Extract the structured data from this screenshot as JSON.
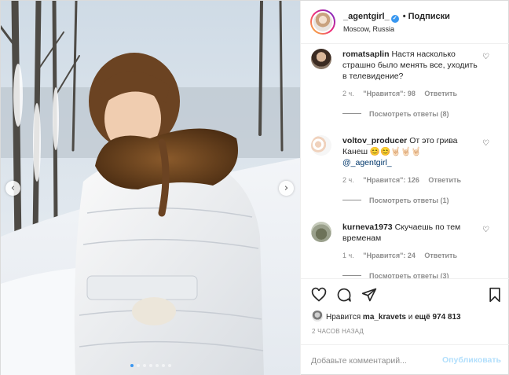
{
  "post": {
    "username": "_agentgirl_",
    "separator": "•",
    "follow_label": "Подписки",
    "location": "Moscow, Russia",
    "photo": {
      "subject": "girl-in-white-winter-coat-photo",
      "slide_count": 7,
      "active_slide": 1
    }
  },
  "comments": [
    {
      "username": "romatsaplin",
      "text": "Настя насколько страшно было менять все, уходить в телевидение?",
      "time": "2 ч.",
      "likes_label": "\"Нравится\": 98",
      "reply_label": "Ответить",
      "view_replies": "Посмотреть ответы (8)"
    },
    {
      "username": "voltov_producer",
      "text": "От это грива Канеш 😊😊🤘🏻🤘🏻🤘🏻",
      "mention": "@_agentgirl_",
      "time": "2 ч.",
      "likes_label": "\"Нравится\": 126",
      "reply_label": "Ответить",
      "view_replies": "Посмотреть ответы (1)"
    },
    {
      "username": "kurneva1973",
      "text": "Скучаешь по тем временам",
      "time": "1 ч.",
      "likes_label": "\"Нравится\": 24",
      "reply_label": "Ответить",
      "view_replies": "Посмотреть ответы (3)"
    }
  ],
  "likes": {
    "prefix": "Нравится",
    "user": "ma_kravets",
    "middle": "и",
    "others": "ещё 974 813"
  },
  "timestamp": "2 ЧАСОВ НАЗАД",
  "comment_box": {
    "placeholder": "Добавьте комментарий...",
    "post_label": "Опубликовать"
  },
  "colors": {
    "accent": "#0095f6",
    "post_disabled": "#b2dffc",
    "secondary_text": "#8e8e8e",
    "border": "#efefef"
  },
  "icons": {
    "like": "heart-icon",
    "comment": "comment-icon",
    "share": "paper-plane-icon",
    "save": "bookmark-icon"
  }
}
